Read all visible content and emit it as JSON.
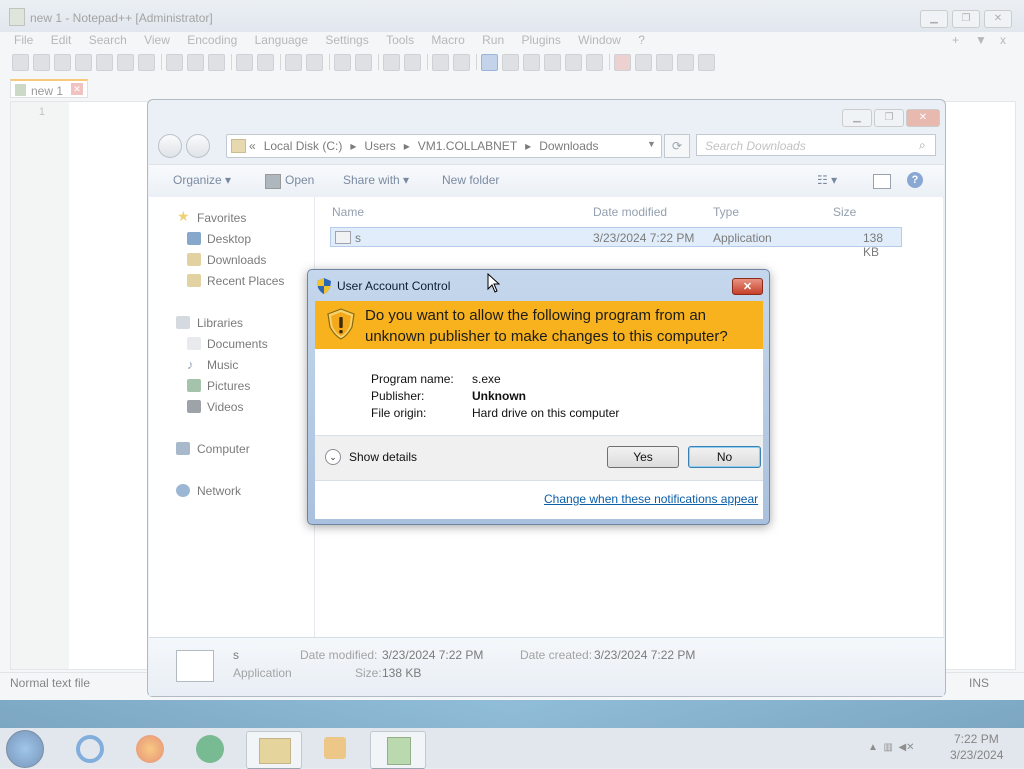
{
  "npp": {
    "title": "new 1 - Notepad++ [Administrator]",
    "menu": [
      "File",
      "Edit",
      "Search",
      "View",
      "Encoding",
      "Language",
      "Settings",
      "Tools",
      "Macro",
      "Run",
      "Plugins",
      "Window",
      "?"
    ],
    "menu_right": [
      "+",
      "▼",
      "x"
    ],
    "tab_label": "new 1",
    "line_number": "1",
    "status_left": "Normal text file",
    "status_right": "INS"
  },
  "explorer": {
    "breadcrumb": [
      "«",
      "Local Disk (C:)",
      "▸",
      "Users",
      "▸",
      "VM1.COLLABNET",
      "▸",
      "Downloads"
    ],
    "search_placeholder": "Search Downloads",
    "commands": {
      "organize": "Organize ▾",
      "open": "Open",
      "share": "Share with ▾",
      "new_folder": "New folder"
    },
    "nav": {
      "favorites": "Favorites",
      "desktop": "Desktop",
      "downloads": "Downloads",
      "recent": "Recent Places",
      "libraries": "Libraries",
      "documents": "Documents",
      "music": "Music",
      "pictures": "Pictures",
      "videos": "Videos",
      "computer": "Computer",
      "network": "Network"
    },
    "columns": {
      "name": "Name",
      "date": "Date modified",
      "type": "Type",
      "size": "Size"
    },
    "file": {
      "name": "s",
      "date": "3/23/2024 7:22 PM",
      "type": "Application",
      "size": "138 KB"
    },
    "details": {
      "name": "s",
      "type": "Application",
      "date_modified_label": "Date modified:",
      "date_modified": "3/23/2024 7:22 PM",
      "date_created_label": "Date created:",
      "date_created": "3/23/2024 7:22 PM",
      "size_label": "Size:",
      "size": "138 KB"
    }
  },
  "uac": {
    "title": "User Account Control",
    "question": "Do you want to allow the following program from an unknown publisher to make changes to this computer?",
    "program_name_label": "Program name:",
    "program_name": "s.exe",
    "publisher_label": "Publisher:",
    "publisher": "Unknown",
    "origin_label": "File origin:",
    "origin": "Hard drive on this computer",
    "show_details": "Show details",
    "yes": "Yes",
    "no": "No",
    "link": "Change when these notifications appear",
    "banner_color": "#f7b21e"
  },
  "taskbar": {
    "time": "7:22 PM",
    "date": "3/23/2024"
  }
}
